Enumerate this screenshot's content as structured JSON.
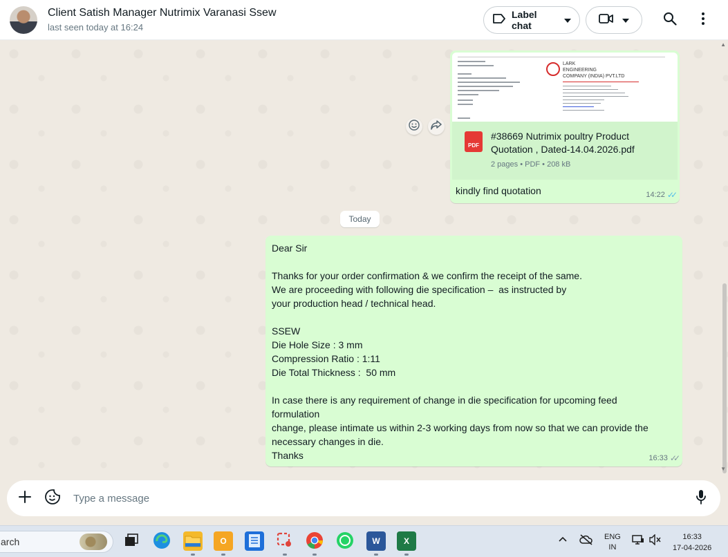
{
  "header": {
    "contact_name": "Client Satish Manager Nutrimix Varanasi Ssew",
    "status": "last seen today at 16:24",
    "label_chat": "Label chat"
  },
  "messages": {
    "doc": {
      "preview_company": [
        "LARK",
        "ENGINEERING",
        "COMPANY (INDIA) PVT.LTD"
      ],
      "file_name_line1": "#38669 Nutrimix poultry Product",
      "file_name_line2": "Quotation , Dated-14.04.2026.pdf",
      "file_type_badge": "PDF",
      "meta": "2 pages • PDF • 208 kB",
      "caption": "kindly find quotation",
      "time": "14:22",
      "status": "read"
    },
    "day_divider": "Today",
    "text": {
      "lines": [
        "Dear Sir",
        "",
        "Thanks for your order confirmation & we confirm the receipt of the same.",
        "We are proceeding with following die specification –  as instructed by",
        "your production head / technical head.",
        "",
        "SSEW",
        "Die Hole Size : 3 mm",
        "Compression Ratio : 1:11",
        "Die Total Thickness :  50 mm",
        "",
        "In case there is any requirement of change in die specification for upcoming feed",
        "formulation",
        "change, please intimate us within 2-3 working days from now so that we can provide the",
        "necessary changes in die.",
        "Thanks"
      ],
      "time": "16:33",
      "status": "delivered"
    }
  },
  "composer": {
    "placeholder": "Type a message"
  },
  "taskbar": {
    "search_text": "arch",
    "lang_line1": "ENG",
    "lang_line2": "IN",
    "clock_time": "16:33",
    "clock_date": "17-04-2026"
  },
  "colors": {
    "outgoing_bubble": "#d9fdd3",
    "read_ticks": "#53bdeb",
    "chat_background": "#efeae2"
  }
}
